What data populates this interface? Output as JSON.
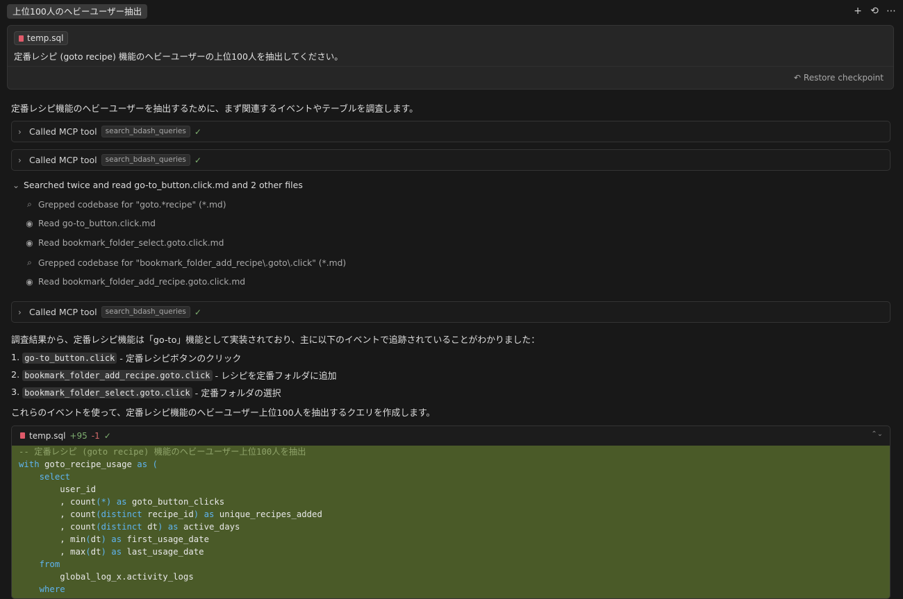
{
  "header": {
    "title": "上位100人のヘビーユーザー抽出",
    "actions": [
      "+",
      "⟲",
      "⋯"
    ]
  },
  "message": {
    "file_chip": "temp.sql",
    "text": "定番レシピ (goto recipe) 機能のヘビーユーザーの上位100人を抽出してください。",
    "restore_label": "Restore checkpoint"
  },
  "intro": "定番レシピ機能のヘビーユーザーを抽出するために、まず関連するイベントやテーブルを調査します。",
  "tool_calls": [
    {
      "label": "Called MCP tool",
      "tag": "search_bdash_queries"
    },
    {
      "label": "Called MCP tool",
      "tag": "search_bdash_queries"
    },
    {
      "label": "Called MCP tool",
      "tag": "search_bdash_queries"
    }
  ],
  "search_group": {
    "heading": "Searched twice and read go-to_button.click.md and 2 other files",
    "items": [
      {
        "icon": "search-icon",
        "text": "Grepped codebase for \"goto.*recipe\" (*.md)"
      },
      {
        "icon": "eye-icon",
        "text": "Read go-to_button.click.md"
      },
      {
        "icon": "eye-icon",
        "text": "Read bookmark_folder_select.goto.click.md"
      },
      {
        "icon": "search-icon",
        "text": "Grepped codebase for \"bookmark_folder_add_recipe\\.goto\\.click\" (*.md)"
      },
      {
        "icon": "eye-icon",
        "text": "Read bookmark_folder_add_recipe.goto.click.md"
      }
    ]
  },
  "findings": "調査結果から、定番レシピ機能は「go-to」機能として実装されており、主に以下のイベントで追跡されていることがわかりました：",
  "events": [
    {
      "num": "1.",
      "code": "go-to_button.click",
      "desc": "- 定番レシピボタンのクリック"
    },
    {
      "num": "2.",
      "code": "bookmark_folder_add_recipe.goto.click",
      "desc": "- レシピを定番フォルダに追加"
    },
    {
      "num": "3.",
      "code": "bookmark_folder_select.goto.click",
      "desc": "- 定番フォルダの選択"
    }
  ],
  "plan": "これらのイベントを使って、定番レシピ機能のヘビーユーザー上位100人を抽出するクエリを作成します。",
  "code_panel": {
    "file": "temp.sql",
    "added": "+95",
    "removed": "-1",
    "lines": [
      "-- 定番レシピ (goto recipe) 機能のヘビーユーザー上位100人を抽出",
      "with goto_recipe_usage as (",
      "    select",
      "        user_id",
      "        , count(*) as goto_button_clicks",
      "        , count(distinct recipe_id) as unique_recipes_added",
      "        , count(distinct dt) as active_days",
      "        , min(dt) as first_usage_date",
      "        , max(dt) as last_usage_date",
      "    from",
      "        global_log_x.activity_logs",
      "    where"
    ]
  }
}
